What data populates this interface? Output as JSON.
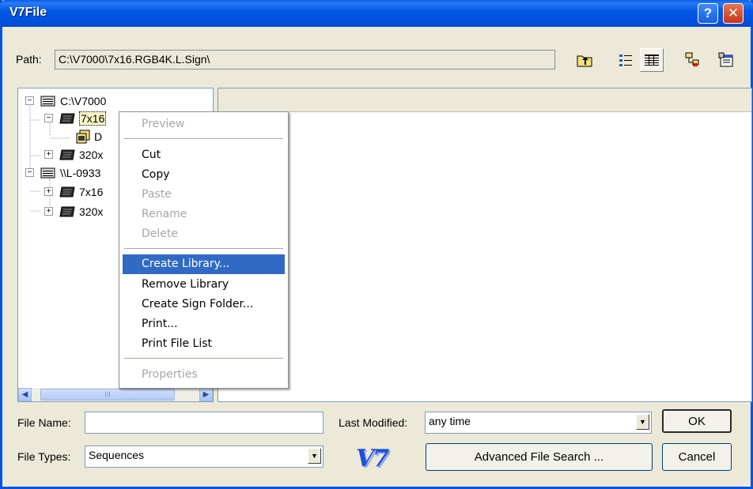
{
  "window": {
    "title": "V7File",
    "help_glyph": "?",
    "close_glyph": "✕"
  },
  "path": {
    "label": "Path:",
    "value": "C:\\V7000\\7x16.RGB4K.L.Sign\\"
  },
  "toolbar": {
    "icons": [
      "up-folder-icon",
      "list-view-icon",
      "details-view-icon",
      "network-icon",
      "properties-icon"
    ]
  },
  "tree": {
    "items": [
      {
        "label": "C:\\V7000",
        "icon": "drive-icon",
        "expander": "−"
      },
      {
        "label": "7x16",
        "icon": "sign-icon",
        "expander": "−"
      },
      {
        "label": "D",
        "icon": "library-icon",
        "expander": ""
      },
      {
        "label": "320x",
        "icon": "sign-icon",
        "expander": "+"
      },
      {
        "label": "\\\\L-0933",
        "icon": "drive-icon",
        "expander": "−"
      },
      {
        "label": "7x16",
        "icon": "sign-icon",
        "expander": "+"
      },
      {
        "label": "320x",
        "icon": "sign-icon",
        "expander": "+"
      }
    ],
    "scroll_grip": "III"
  },
  "context_menu": {
    "items": [
      {
        "label": "Preview",
        "enabled": false
      },
      {
        "label": "Cut",
        "enabled": true
      },
      {
        "label": "Copy",
        "enabled": true
      },
      {
        "label": "Paste",
        "enabled": false
      },
      {
        "label": "Rename",
        "enabled": false
      },
      {
        "label": "Delete",
        "enabled": false
      },
      {
        "label": "Create Library...",
        "enabled": true,
        "selected": true
      },
      {
        "label": "Remove Library",
        "enabled": true
      },
      {
        "label": "Create Sign Folder...",
        "enabled": true
      },
      {
        "label": "Print...",
        "enabled": true
      },
      {
        "label": "Print File List",
        "enabled": true
      },
      {
        "label": "Properties",
        "enabled": false
      }
    ]
  },
  "form": {
    "file_name_label": "File Name:",
    "file_name_value": "",
    "file_types_label": "File Types:",
    "file_types_value": "Sequences",
    "last_modified_label": "Last Modified:",
    "last_modified_value": "any time",
    "ok_label": "OK",
    "cancel_label": "Cancel",
    "advanced_label": "Advanced File Search ...",
    "logo_text": "V7"
  },
  "colors": {
    "titlebar": "#0058e6",
    "selection": "#316ac5",
    "disabled_text": "#a7a6aa"
  }
}
